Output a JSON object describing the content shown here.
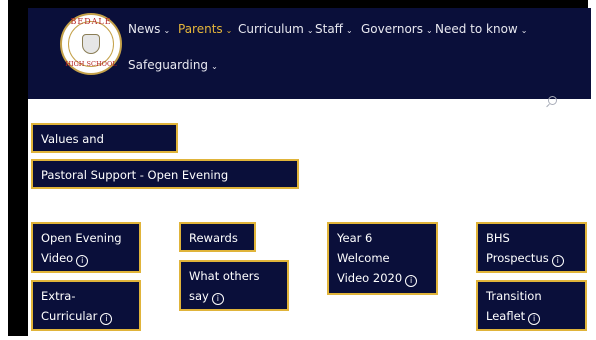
{
  "header": {
    "logo": {
      "top_text": "BEDALE",
      "bottom_text": "HIGH SCHOOL"
    },
    "nav": [
      {
        "label": "News",
        "active": false
      },
      {
        "label": "Parents",
        "active": true
      },
      {
        "label": "Curriculum",
        "active": false
      },
      {
        "label": "Staff",
        "active": false
      },
      {
        "label": "Governors",
        "active": false
      },
      {
        "label": "Need to know",
        "active": false
      },
      {
        "label": "Safeguarding",
        "active": false
      }
    ],
    "chevron": "⌄"
  },
  "buttons": {
    "values_curriculum": "Values and Curriculum",
    "pastoral_support": "Pastoral Support - Open Evening Presentation",
    "open_evening_1": "Open Evening",
    "open_evening_2": "Video",
    "rewards": "Rewards",
    "what_others_1": "What others",
    "what_others_2": "say",
    "year6_1": "Year 6",
    "year6_2": "Welcome",
    "year6_3": "Video 2020",
    "bhs_1": "BHS",
    "bhs_2": "Prospectus",
    "extra_1": "Extra-",
    "extra_2": "Curricular",
    "transition_1": "Transition",
    "transition_2": "Leaflet"
  },
  "info_glyph": "i",
  "colors": {
    "navy": "#0a0f3a",
    "gold": "#e0b43a",
    "active_nav": "#e4b53a"
  }
}
